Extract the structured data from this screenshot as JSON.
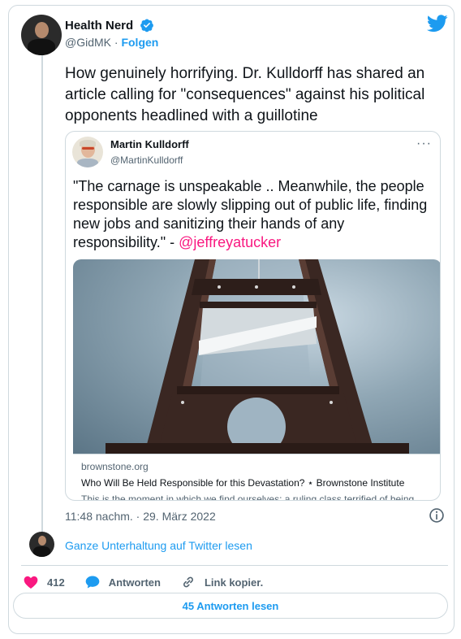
{
  "tweet": {
    "author_name": "Health Nerd",
    "author_handle": "@GidMK",
    "separator": "·",
    "follow_label": "Folgen",
    "text": "How genuinely horrifying. Dr. Kulldorff has shared an article calling for \"consequences\" against his political opponents headlined with a guillotine",
    "timestamp": "11:48 nachm. · 29. März 2022"
  },
  "quote": {
    "author_name": "Martin Kulldorff",
    "author_handle": "@MartinKulldorff",
    "more_label": "···",
    "text": "\"The carnage is unspeakable .. Meanwhile, the people responsible are slowly slipping out of public life, finding new jobs and sanitizing their hands of any responsibility.\" - ",
    "mention": "@jeffreyatucker",
    "link": {
      "domain": "brownstone.org",
      "title": "Who Will Be Held Responsible for this Devastation? ⋆ Brownstone Institute",
      "description": "This is the moment in which we find ourselves: a ruling class terrified of being"
    }
  },
  "conversation_link": "Ganze Unterhaltung auf Twitter lesen",
  "actions": {
    "likes": "412",
    "reply_label": "Antworten",
    "copy_link_label": "Link kopier."
  },
  "read_replies_button": "45 Antworten lesen",
  "colors": {
    "accent": "#1d9bf0",
    "like": "#f91880",
    "text": "#0f1419",
    "muted": "#536471",
    "border": "#cfd9de"
  },
  "icons": [
    "verified-icon",
    "twitter-bird-icon",
    "more-icon",
    "info-icon",
    "heart-icon",
    "reply-icon",
    "link-icon"
  ]
}
